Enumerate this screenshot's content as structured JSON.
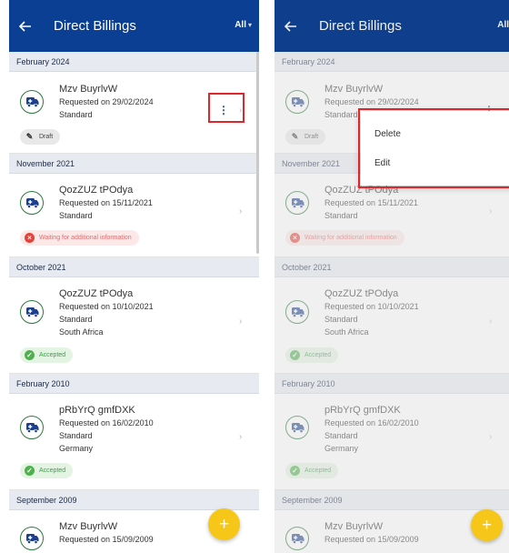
{
  "header": {
    "title": "Direct Billings",
    "filter_label": "All"
  },
  "sections": [
    {
      "label": "February 2024"
    },
    {
      "label": "November 2021"
    },
    {
      "label": "October 2021"
    },
    {
      "label": "February 2010"
    },
    {
      "label": "September 2009"
    }
  ],
  "items": [
    {
      "name": "Mzv BuyrlvW",
      "requested": "Requested on 29/02/2024",
      "type": "Standard",
      "country": "",
      "status": "Draft"
    },
    {
      "name": "QozZUZ tPOdya",
      "requested": "Requested on 15/11/2021",
      "type": "Standard",
      "country": "",
      "status": "Waiting for additional information"
    },
    {
      "name": "QozZUZ tPOdya",
      "requested": "Requested on 10/10/2021",
      "type": "Standard",
      "country": "South Africa",
      "status": "Accepted"
    },
    {
      "name": "pRbYrQ gmfDXK",
      "requested": "Requested on 16/02/2010",
      "type": "Standard",
      "country": "Germany",
      "status": "Accepted"
    },
    {
      "name": "Mzv BuyrlvW",
      "requested": "Requested on 15/09/2009",
      "type": "",
      "country": "",
      "status": ""
    }
  ],
  "context_menu": {
    "items": [
      {
        "label": "Delete"
      },
      {
        "label": "Edit"
      }
    ]
  },
  "fab": {
    "label": "+"
  },
  "colors": {
    "appbar": "#0b3f93",
    "accent": "#f6c618",
    "highlight": "#e0262b",
    "accepted": "#4eb14d",
    "waiting": "#e0443b"
  }
}
